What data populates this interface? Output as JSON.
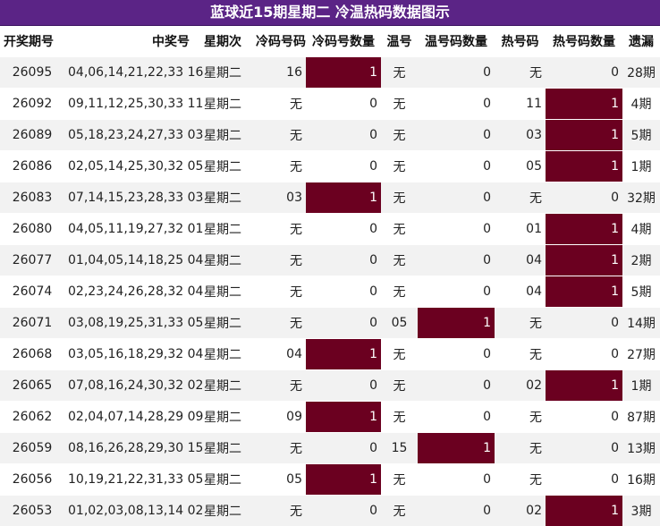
{
  "title": "蓝球近15期星期二 冷温热码数据图示",
  "columns": [
    "开奖期号",
    "中奖号",
    "星期次",
    "冷码号码",
    "冷码号数量",
    "温号",
    "温号码数量",
    "热号码",
    "热号码数量",
    "遗漏"
  ],
  "highlight_color": "#6b0020",
  "header_color": "#5b2486",
  "rows": [
    [
      "26095",
      "04,06,14,21,22,33 16",
      "星期二",
      "16",
      "1",
      "无",
      "0",
      "无",
      "0",
      "28期"
    ],
    [
      "26092",
      "09,11,12,25,30,33 11",
      "星期二",
      "无",
      "0",
      "无",
      "0",
      "11",
      "1",
      "4期"
    ],
    [
      "26089",
      "05,18,23,24,27,33 03",
      "星期二",
      "无",
      "0",
      "无",
      "0",
      "03",
      "1",
      "5期"
    ],
    [
      "26086",
      "02,05,14,25,30,32 05",
      "星期二",
      "无",
      "0",
      "无",
      "0",
      "05",
      "1",
      "1期"
    ],
    [
      "26083",
      "07,14,15,23,28,33 03",
      "星期二",
      "03",
      "1",
      "无",
      "0",
      "无",
      "0",
      "32期"
    ],
    [
      "26080",
      "04,05,11,19,27,32 01",
      "星期二",
      "无",
      "0",
      "无",
      "0",
      "01",
      "1",
      "4期"
    ],
    [
      "26077",
      "01,04,05,14,18,25 04",
      "星期二",
      "无",
      "0",
      "无",
      "0",
      "04",
      "1",
      "2期"
    ],
    [
      "26074",
      "02,23,24,26,28,32 04",
      "星期二",
      "无",
      "0",
      "无",
      "0",
      "04",
      "1",
      "5期"
    ],
    [
      "26071",
      "03,08,19,25,31,33 05",
      "星期二",
      "无",
      "0",
      "05",
      "1",
      "无",
      "0",
      "14期"
    ],
    [
      "26068",
      "03,05,16,18,29,32 04",
      "星期二",
      "04",
      "1",
      "无",
      "0",
      "无",
      "0",
      "27期"
    ],
    [
      "26065",
      "07,08,16,24,30,32 02",
      "星期二",
      "无",
      "0",
      "无",
      "0",
      "02",
      "1",
      "1期"
    ],
    [
      "26062",
      "02,04,07,14,28,29 09",
      "星期二",
      "09",
      "1",
      "无",
      "0",
      "无",
      "0",
      "87期"
    ],
    [
      "26059",
      "08,16,26,28,29,30 15",
      "星期二",
      "无",
      "0",
      "15",
      "1",
      "无",
      "0",
      "13期"
    ],
    [
      "26056",
      "10,19,21,22,31,33 05",
      "星期二",
      "05",
      "1",
      "无",
      "0",
      "无",
      "0",
      "16期"
    ],
    [
      "26053",
      "01,02,03,08,13,14 02",
      "星期二",
      "无",
      "0",
      "无",
      "0",
      "02",
      "1",
      "3期"
    ]
  ]
}
